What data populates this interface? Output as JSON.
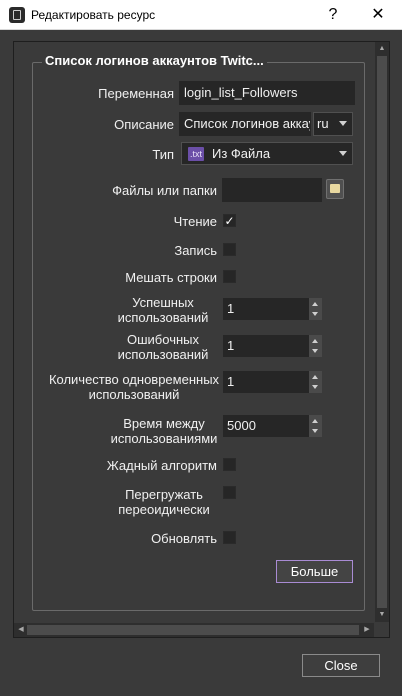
{
  "window": {
    "title": "Редактировать ресурс",
    "help_label": "?",
    "close_glyph": "✕"
  },
  "group": {
    "title": "Список логинов аккаунтов Twitc..."
  },
  "form": {
    "variable": {
      "label": "Переменная",
      "value": "login_list_Followers"
    },
    "description": {
      "label": "Описание",
      "value": "Список логинов аккау",
      "lang": "ru"
    },
    "type": {
      "label": "Тип",
      "badge": ".txt",
      "value": "Из Файла"
    },
    "files": {
      "label": "Файлы или папки",
      "value": ""
    },
    "read": {
      "label": "Чтение",
      "checked": true,
      "mark": "✓"
    },
    "write": {
      "label": "Запись",
      "checked": false
    },
    "shuffle": {
      "label": "Мешать строки",
      "checked": false
    },
    "success_uses": {
      "label": "Успешных использований",
      "value": "1"
    },
    "failed_uses": {
      "label": "Ошибочных использований",
      "value": "1"
    },
    "concurrent_uses": {
      "label": "Количество одновременных использований",
      "value": "1"
    },
    "interval": {
      "label": "Время между использованиями",
      "value": "5000"
    },
    "greedy": {
      "label": "Жадный алгоритм",
      "checked": false
    },
    "reload": {
      "label": "Перегружать переоидически",
      "checked": false
    },
    "refresh": {
      "label": "Обновлять",
      "checked": false
    },
    "more_button": "Больше"
  },
  "footer": {
    "close_button": "Close"
  },
  "colors": {
    "background": "#3a3a3a",
    "field": "#262626",
    "accent_border": "#a98bd4",
    "badge_bg": "#6b4fa8"
  }
}
